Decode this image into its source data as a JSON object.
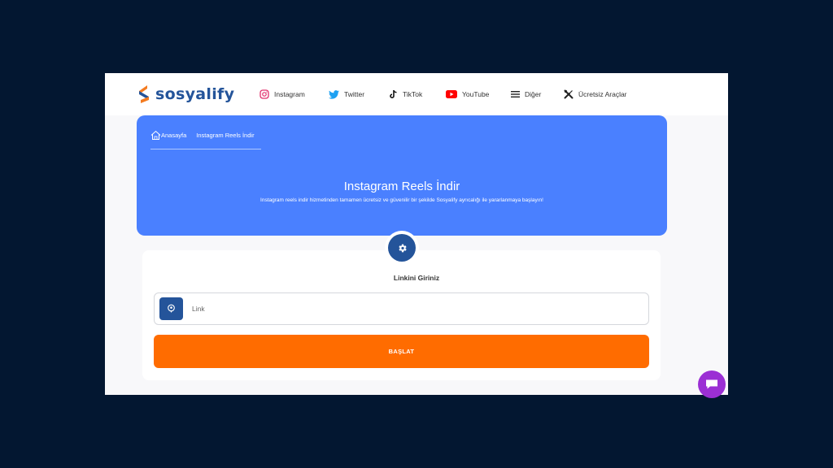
{
  "brand": {
    "name": "sosyalify",
    "primary": "#24549a",
    "accent": "#f47b20"
  },
  "nav": {
    "items": [
      {
        "label": "Instagram",
        "icon": "instagram-icon"
      },
      {
        "label": "Twitter",
        "icon": "twitter-icon"
      },
      {
        "label": "TikTok",
        "icon": "tiktok-icon"
      },
      {
        "label": "YouTube",
        "icon": "youtube-icon"
      },
      {
        "label": "Diğer",
        "icon": "menu-icon"
      },
      {
        "label": "Ücretsiz Araçlar",
        "icon": "tools-icon"
      }
    ]
  },
  "breadcrumb": {
    "home": "Anasayfa",
    "current": "Instagram Reels İndir"
  },
  "hero": {
    "title": "Instagram Reels İndir",
    "subtitle": "Instagram reels indir hizmetinden tamamen ücretsiz ve güvenilir bir şekilde Sosyalify ayrıcalığı ile yararlanmaya başlayın!",
    "color": "#4a80ff"
  },
  "form": {
    "heading": "Linkini Giriniz",
    "input_placeholder": "Link",
    "input_value": "",
    "submit_label": "BAŞLAT",
    "submit_color": "#ff6c00"
  },
  "chat": {
    "icon": "chat-icon",
    "color": "#9b2fd4"
  }
}
